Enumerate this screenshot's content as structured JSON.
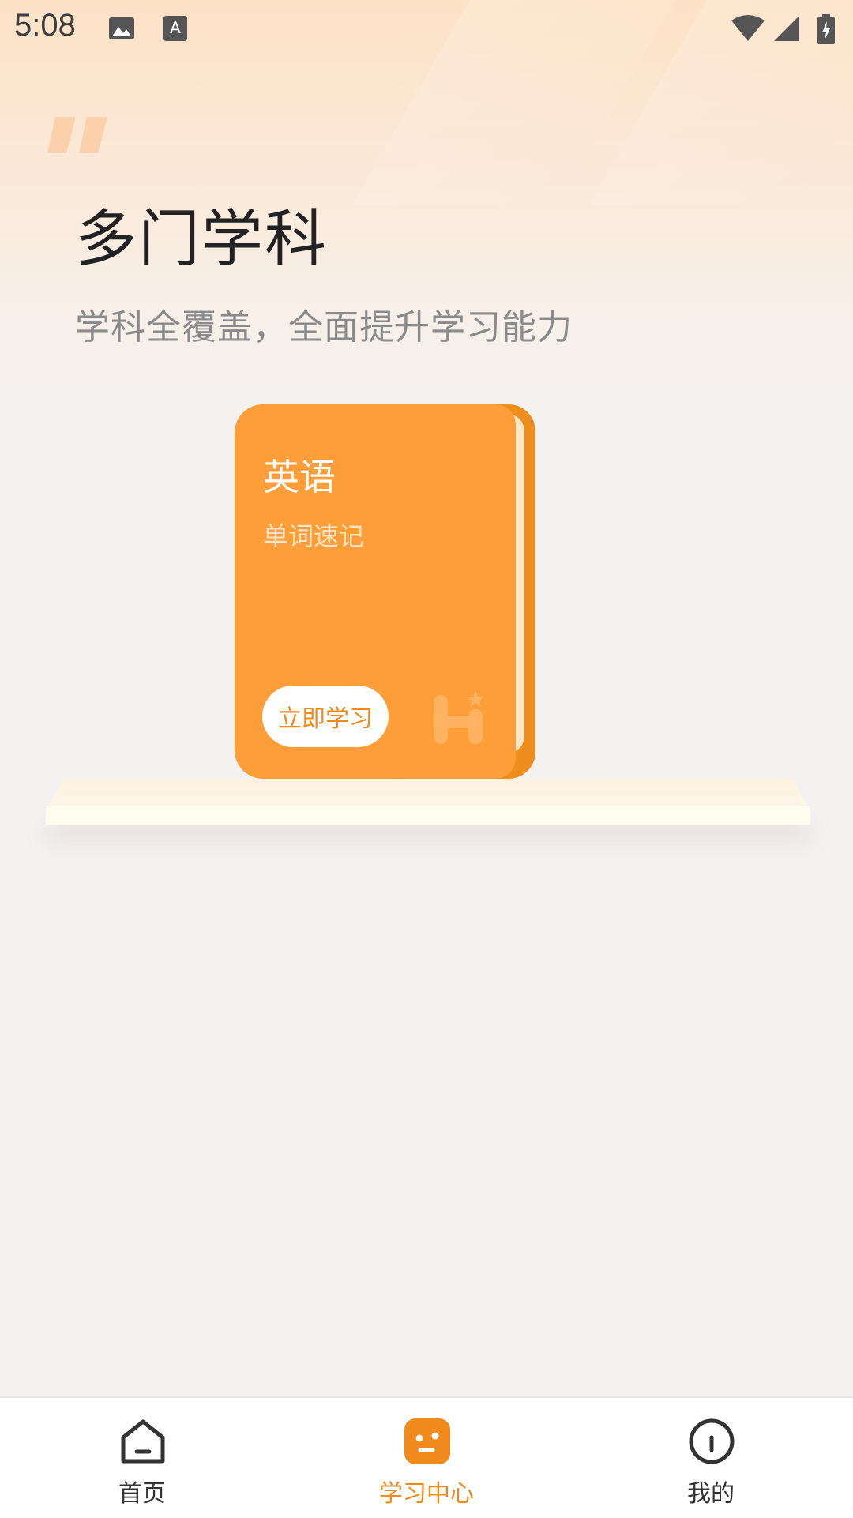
{
  "status_bar": {
    "time": "5:08"
  },
  "header": {
    "title": "多门学科",
    "subtitle": "学科全覆盖，全面提升学习能力"
  },
  "book": {
    "title": "英语",
    "subtitle": "单词速记",
    "button_label": "立即学习",
    "color": "#fe9e38"
  },
  "bottom_nav": {
    "items": [
      {
        "label": "首页",
        "icon": "home-icon",
        "active": false
      },
      {
        "label": "学习中心",
        "icon": "study-center-icon",
        "active": true
      },
      {
        "label": "我的",
        "icon": "profile-icon",
        "active": false
      }
    ],
    "active_color": "#f08a1c"
  }
}
